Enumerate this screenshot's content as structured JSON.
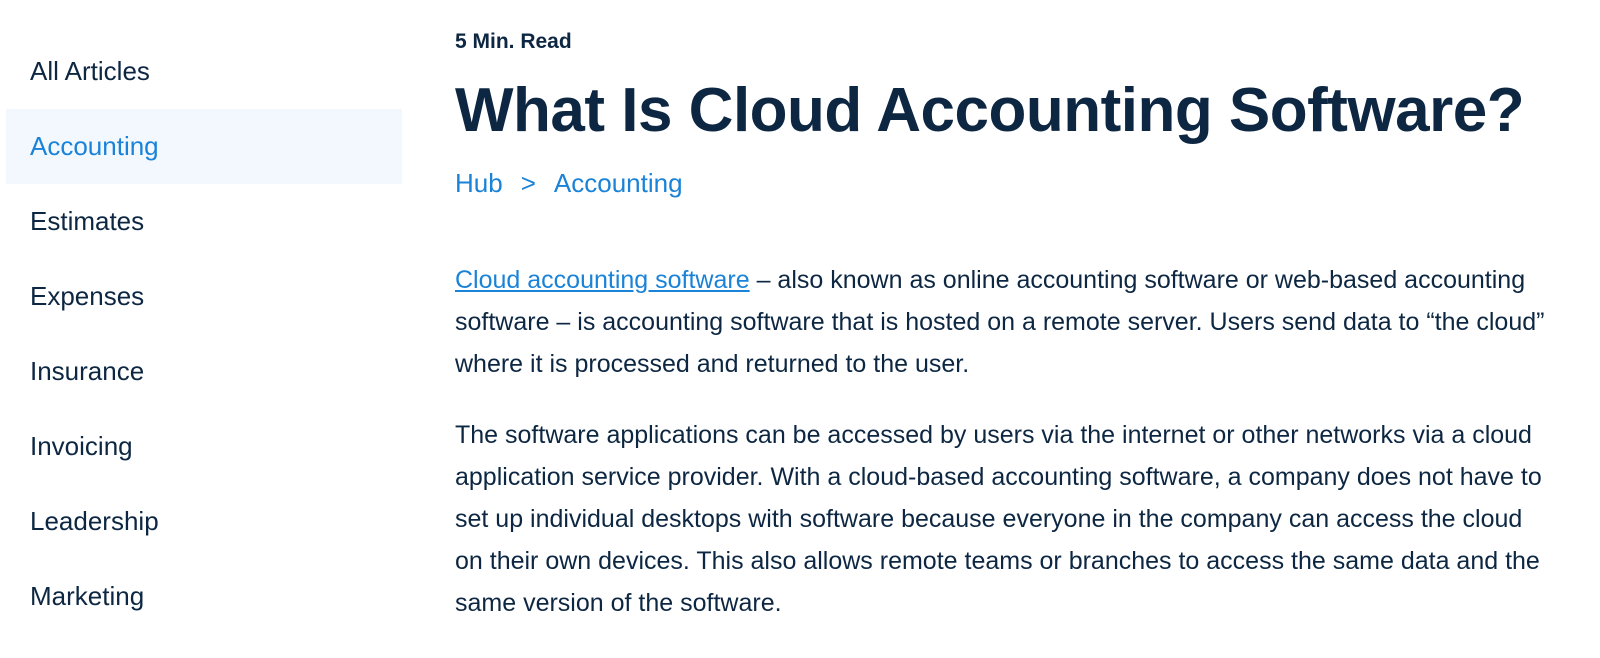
{
  "sidebar": {
    "items": [
      {
        "label": "All Articles",
        "active": false
      },
      {
        "label": "Accounting",
        "active": true
      },
      {
        "label": "Estimates",
        "active": false
      },
      {
        "label": "Expenses",
        "active": false
      },
      {
        "label": "Insurance",
        "active": false
      },
      {
        "label": "Invoicing",
        "active": false
      },
      {
        "label": "Leadership",
        "active": false
      },
      {
        "label": "Marketing",
        "active": false
      }
    ]
  },
  "article": {
    "read_time": "5 Min. Read",
    "title": "What Is Cloud Accounting Software?",
    "breadcrumb": {
      "items": [
        "Hub",
        "Accounting"
      ],
      "separator": ">"
    },
    "paragraph1": {
      "link_text": "Cloud accounting software",
      "text": " – also known as online accounting software or web-based accounting software – is accounting software that is hosted on a remote server. Users send data to “the cloud” where it is processed and returned to the user."
    },
    "paragraph2": "The software applications can be accessed by users via the internet or other networks via a cloud application service provider. With a cloud-based accounting software, a company does not have to set up individual desktops with software because everyone in the company can access the cloud on their own devices. This also allows remote teams or branches to access the same data and the same version of the software."
  },
  "colors": {
    "text": "#0d2742",
    "link": "#1b83d7",
    "active_bg": "#f2f8fd"
  }
}
